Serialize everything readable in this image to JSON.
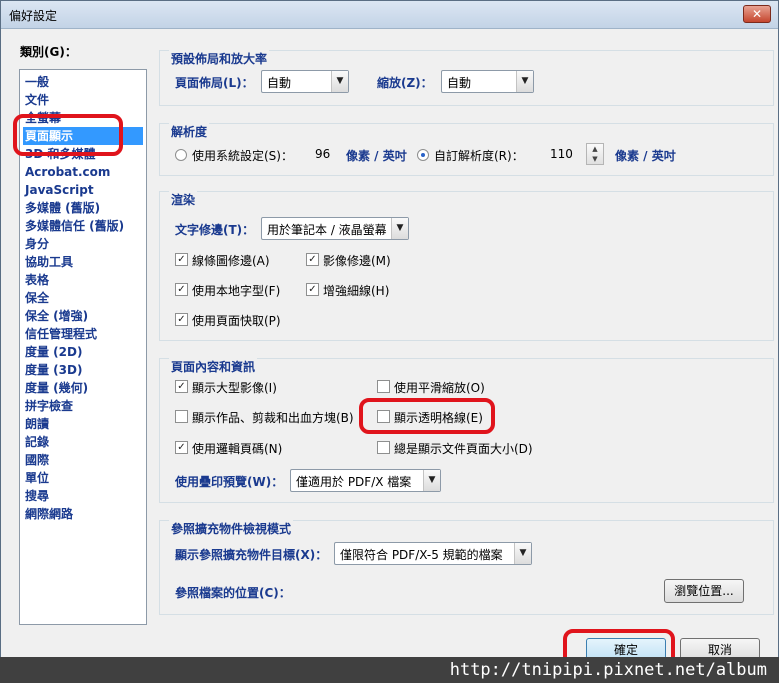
{
  "window": {
    "title": "偏好設定",
    "close_symbol": "✕"
  },
  "category": {
    "label": "類別(G)：",
    "items": [
      "一般",
      "文件",
      "全螢幕",
      "頁面顯示",
      "3D 和多媒體",
      "Acrobat.com",
      "JavaScript",
      "多媒體 (舊版)",
      "多媒體信任 (舊版)",
      "身分",
      "協助工具",
      "表格",
      "保全",
      "保全 (增強)",
      "信任管理程式",
      "度量 (2D)",
      "度量 (3D)",
      "度量 (幾何)",
      "拼字檢查",
      "朗讀",
      "記錄",
      "國際",
      "單位",
      "搜尋",
      "網際網路"
    ],
    "selected_index": 3
  },
  "layout_section": {
    "title": "預設佈局和放大率",
    "page_layout_label": "頁面佈局(L)：",
    "page_layout_value": "自動",
    "zoom_label": "縮放(Z)：",
    "zoom_value": "自動"
  },
  "resolution_section": {
    "title": "解析度",
    "system_option": "使用系統設定(S)：",
    "system_value": "96",
    "unit_1": "像素 / 英吋",
    "custom_option": "自訂解析度(R)：",
    "custom_value": "110",
    "unit_2": "像素 / 英吋",
    "selected": "custom"
  },
  "render_section": {
    "title": "渲染",
    "smooth_text_label": "文字修邊(T)：",
    "smooth_text_value": "用於筆記本 / 液晶螢幕",
    "checkboxes": [
      {
        "label": "線條圖修邊(A)",
        "checked": true
      },
      {
        "label": "影像修邊(M)",
        "checked": true
      },
      {
        "label": "使用本地字型(F)",
        "checked": true
      },
      {
        "label": "增強細線(H)",
        "checked": true
      },
      {
        "label": "使用頁面快取(P)",
        "checked": true
      }
    ]
  },
  "content_section": {
    "title": "頁面內容和資訊",
    "checkboxes": [
      {
        "label": "顯示大型影像(I)",
        "checked": true
      },
      {
        "label": "使用平滑縮放(O)",
        "checked": false
      },
      {
        "label": "顯示作品、剪裁和出血方塊(B)",
        "checked": false
      },
      {
        "label": "顯示透明格線(E)",
        "checked": false
      },
      {
        "label": "使用邏輯頁碼(N)",
        "checked": true
      },
      {
        "label": "總是顯示文件頁面大小(D)",
        "checked": false
      }
    ],
    "overprint_label": "使用疊印預覽(W)：",
    "overprint_value": "僅適用於 PDF/X 檔案"
  },
  "reference_section": {
    "title": "參照擴充物件檢視模式",
    "target_label": "顯示參照擴充物件目標(X)：",
    "target_value": "僅限符合 PDF/X-5 規範的檔案",
    "location_label": "參照檔案的位置(C)：",
    "browse_button": "瀏覽位置..."
  },
  "footer": {
    "ok_button": "確定",
    "cancel_button": "取消"
  },
  "watermark": {
    "text": "http://tnipipi.pixnet.net/album"
  }
}
